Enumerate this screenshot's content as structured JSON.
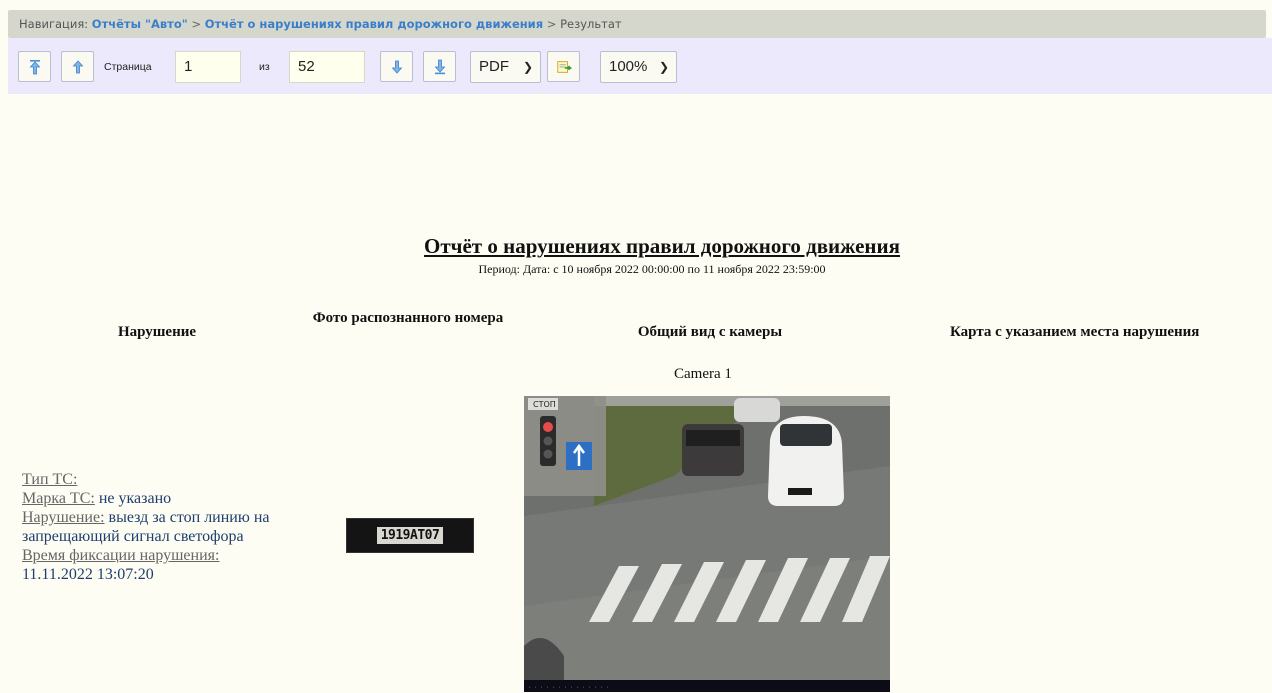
{
  "nav": {
    "prefix": "Навигация:",
    "crumb1": "Отчёты \"Авто\"",
    "sep": ">",
    "crumb2": "Отчёт о нарушениях правил дорожного движения",
    "current": "Результат"
  },
  "toolbar": {
    "page_label": "Страница",
    "page_value": "1",
    "of_label": "из",
    "total_pages": "52",
    "format_value": "PDF",
    "zoom_value": "100%",
    "icons": [
      "first-page-icon",
      "prev-page-icon",
      "next-page-icon",
      "last-page-icon",
      "export-icon"
    ]
  },
  "report": {
    "title": "Отчёт о нарушениях правил дорожного движения",
    "period": "Период: Дата: с 10 ноября 2022 00:00:00 по 11 ноября 2022 23:59:00",
    "columns": [
      "Нарушение",
      "Фото распознанного номера",
      "Общий вид с камеры",
      "Карта с указанием места нарушения"
    ],
    "camera_name": "Camera 1",
    "camera_overlay_sign": "СТОП",
    "plate_text": "1919АТ07",
    "record": {
      "vehicle_type_label": "Тип ТС:",
      "vehicle_type_value": "",
      "brand_label": "Марка ТС:",
      "brand_value": "не указано",
      "violation_label": "Нарушение:",
      "violation_value": "выезд за стоп линию на запрещающий сигнал светофора",
      "time_label": "Время фиксации нарушения:",
      "time_value": "11.11.2022 13:07:20"
    }
  },
  "colors": {
    "background": "#fdfdf3",
    "nav_bar": "#d6d7cc",
    "toolbar": "#ebe9fb",
    "link": "#3a7fc9",
    "record_text": "#1d3e6e"
  }
}
